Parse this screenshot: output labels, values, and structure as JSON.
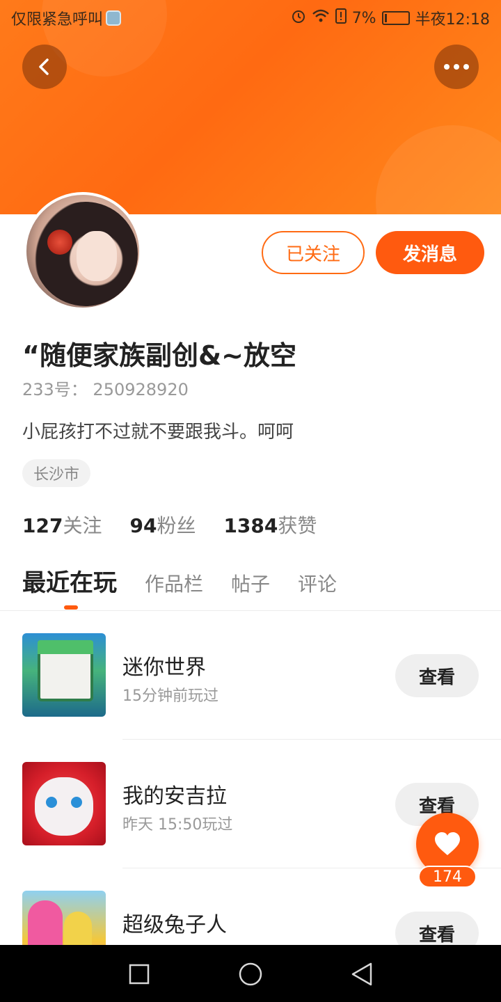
{
  "status_bar": {
    "carrier": "仅限紧急呼叫",
    "battery": "7%",
    "time": "半夜12:18",
    "icons": [
      "shield-icon",
      "alarm-icon",
      "wifi-icon",
      "sim-alert-icon",
      "battery-icon"
    ]
  },
  "header": {
    "back_icon": "chevron-left-icon",
    "more_icon": "more-dots-icon",
    "colors": {
      "accent": "#ff5a0f",
      "header_gradient_start": "#ff7a1a",
      "header_gradient_end": "#ff8a1c"
    }
  },
  "profile": {
    "follow_label": "已关注",
    "message_label": "发消息",
    "username": "“随便家族副创&~放空",
    "id_text": "233号： 250928920",
    "bio": "小屁孩打不过就不要跟我斗。呵呵",
    "location": "长沙市",
    "stats": [
      {
        "value": "127",
        "label": "关注"
      },
      {
        "value": "94",
        "label": "粉丝"
      },
      {
        "value": "1384",
        "label": "获赞"
      }
    ]
  },
  "tabs": [
    {
      "label": "最近在玩",
      "active": true
    },
    {
      "label": "作品栏",
      "active": false
    },
    {
      "label": "帖子",
      "active": false
    },
    {
      "label": "评论",
      "active": false
    }
  ],
  "games": [
    {
      "name": "迷你世界",
      "time": "15分钟前玩过",
      "button": "查看"
    },
    {
      "name": "我的安吉拉",
      "time": "昨天 15:50玩过",
      "button": "查看"
    },
    {
      "name": "超级兔子人",
      "time": "",
      "button": "查看"
    }
  ],
  "like_fab": {
    "icon": "heart-icon",
    "count": "174"
  },
  "nav_bar": {
    "icons": [
      "recent-apps-icon",
      "home-icon",
      "back-triangle-icon"
    ]
  }
}
